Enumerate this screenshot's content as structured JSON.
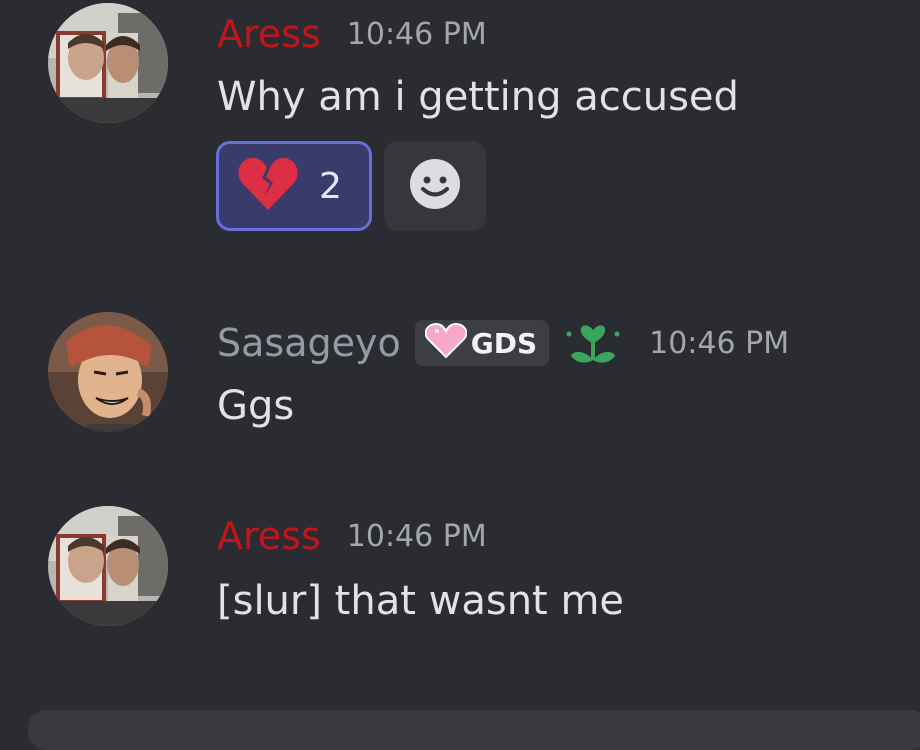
{
  "messages": [
    {
      "username": "Aress",
      "timestamp": "10:46 PM",
      "content": "Why am i getting accused",
      "reactions": [
        {
          "emoji": "broken-heart",
          "count": "2",
          "selected": true
        }
      ],
      "add_reaction_icon": "smile-icon"
    },
    {
      "username": "Sasageyo",
      "tag": {
        "icon": "pink-heart",
        "label": "GDS"
      },
      "role_icon": "green-flower-icon",
      "timestamp": "10:46 PM",
      "content": "Ggs"
    },
    {
      "username": "Aress",
      "timestamp": "10:46 PM",
      "content": "[slur] that wasnt me"
    }
  ],
  "colors": {
    "background": "#2b2c31",
    "aress_name": "#c0151b",
    "sasageyo_name": "#949ba4",
    "reaction_border": "#6770d6",
    "reaction_bg": "#393b6a"
  }
}
